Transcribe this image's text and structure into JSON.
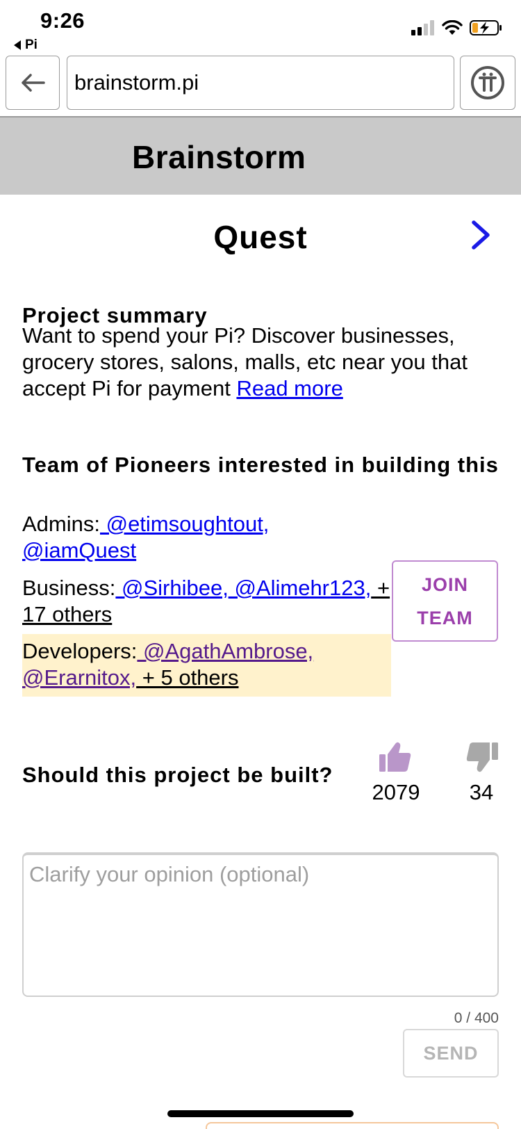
{
  "status_bar": {
    "time": "9:26",
    "back_app": "Pi"
  },
  "browser": {
    "url": "brainstorm.pi"
  },
  "header": {
    "title": "Brainstorm"
  },
  "project": {
    "title": "Quest",
    "summary_heading": "Project summary",
    "summary_text": "Want to spend your Pi? Discover businesses, grocery stores, salons, malls, etc near you that accept Pi for payment",
    "read_more": "Read more"
  },
  "team": {
    "heading": "Team of Pioneers interested in building this",
    "admins_label": "Admins:",
    "admins": [
      " @etimsoughtout,",
      "@iamQuest"
    ],
    "business_label": "Business:",
    "business": [
      " @Sirhibee,",
      " @Alimehr123,"
    ],
    "business_others": " + 17 others",
    "developers_label": "Developers:",
    "developers": [
      " @AgathAmbrose,",
      "@Erarnitox,"
    ],
    "developers_others": " + 5 others",
    "join_line1": "JOIN",
    "join_line2": "TEAM"
  },
  "vote": {
    "question": "Should this project be built?",
    "up_count": "2079",
    "down_count": "34",
    "up_color": "#b996c9",
    "down_color": "#a8a8a8"
  },
  "opinion": {
    "placeholder": "Clarify your opinion (optional)",
    "char_count": "0 / 400",
    "send_label": "SEND"
  }
}
